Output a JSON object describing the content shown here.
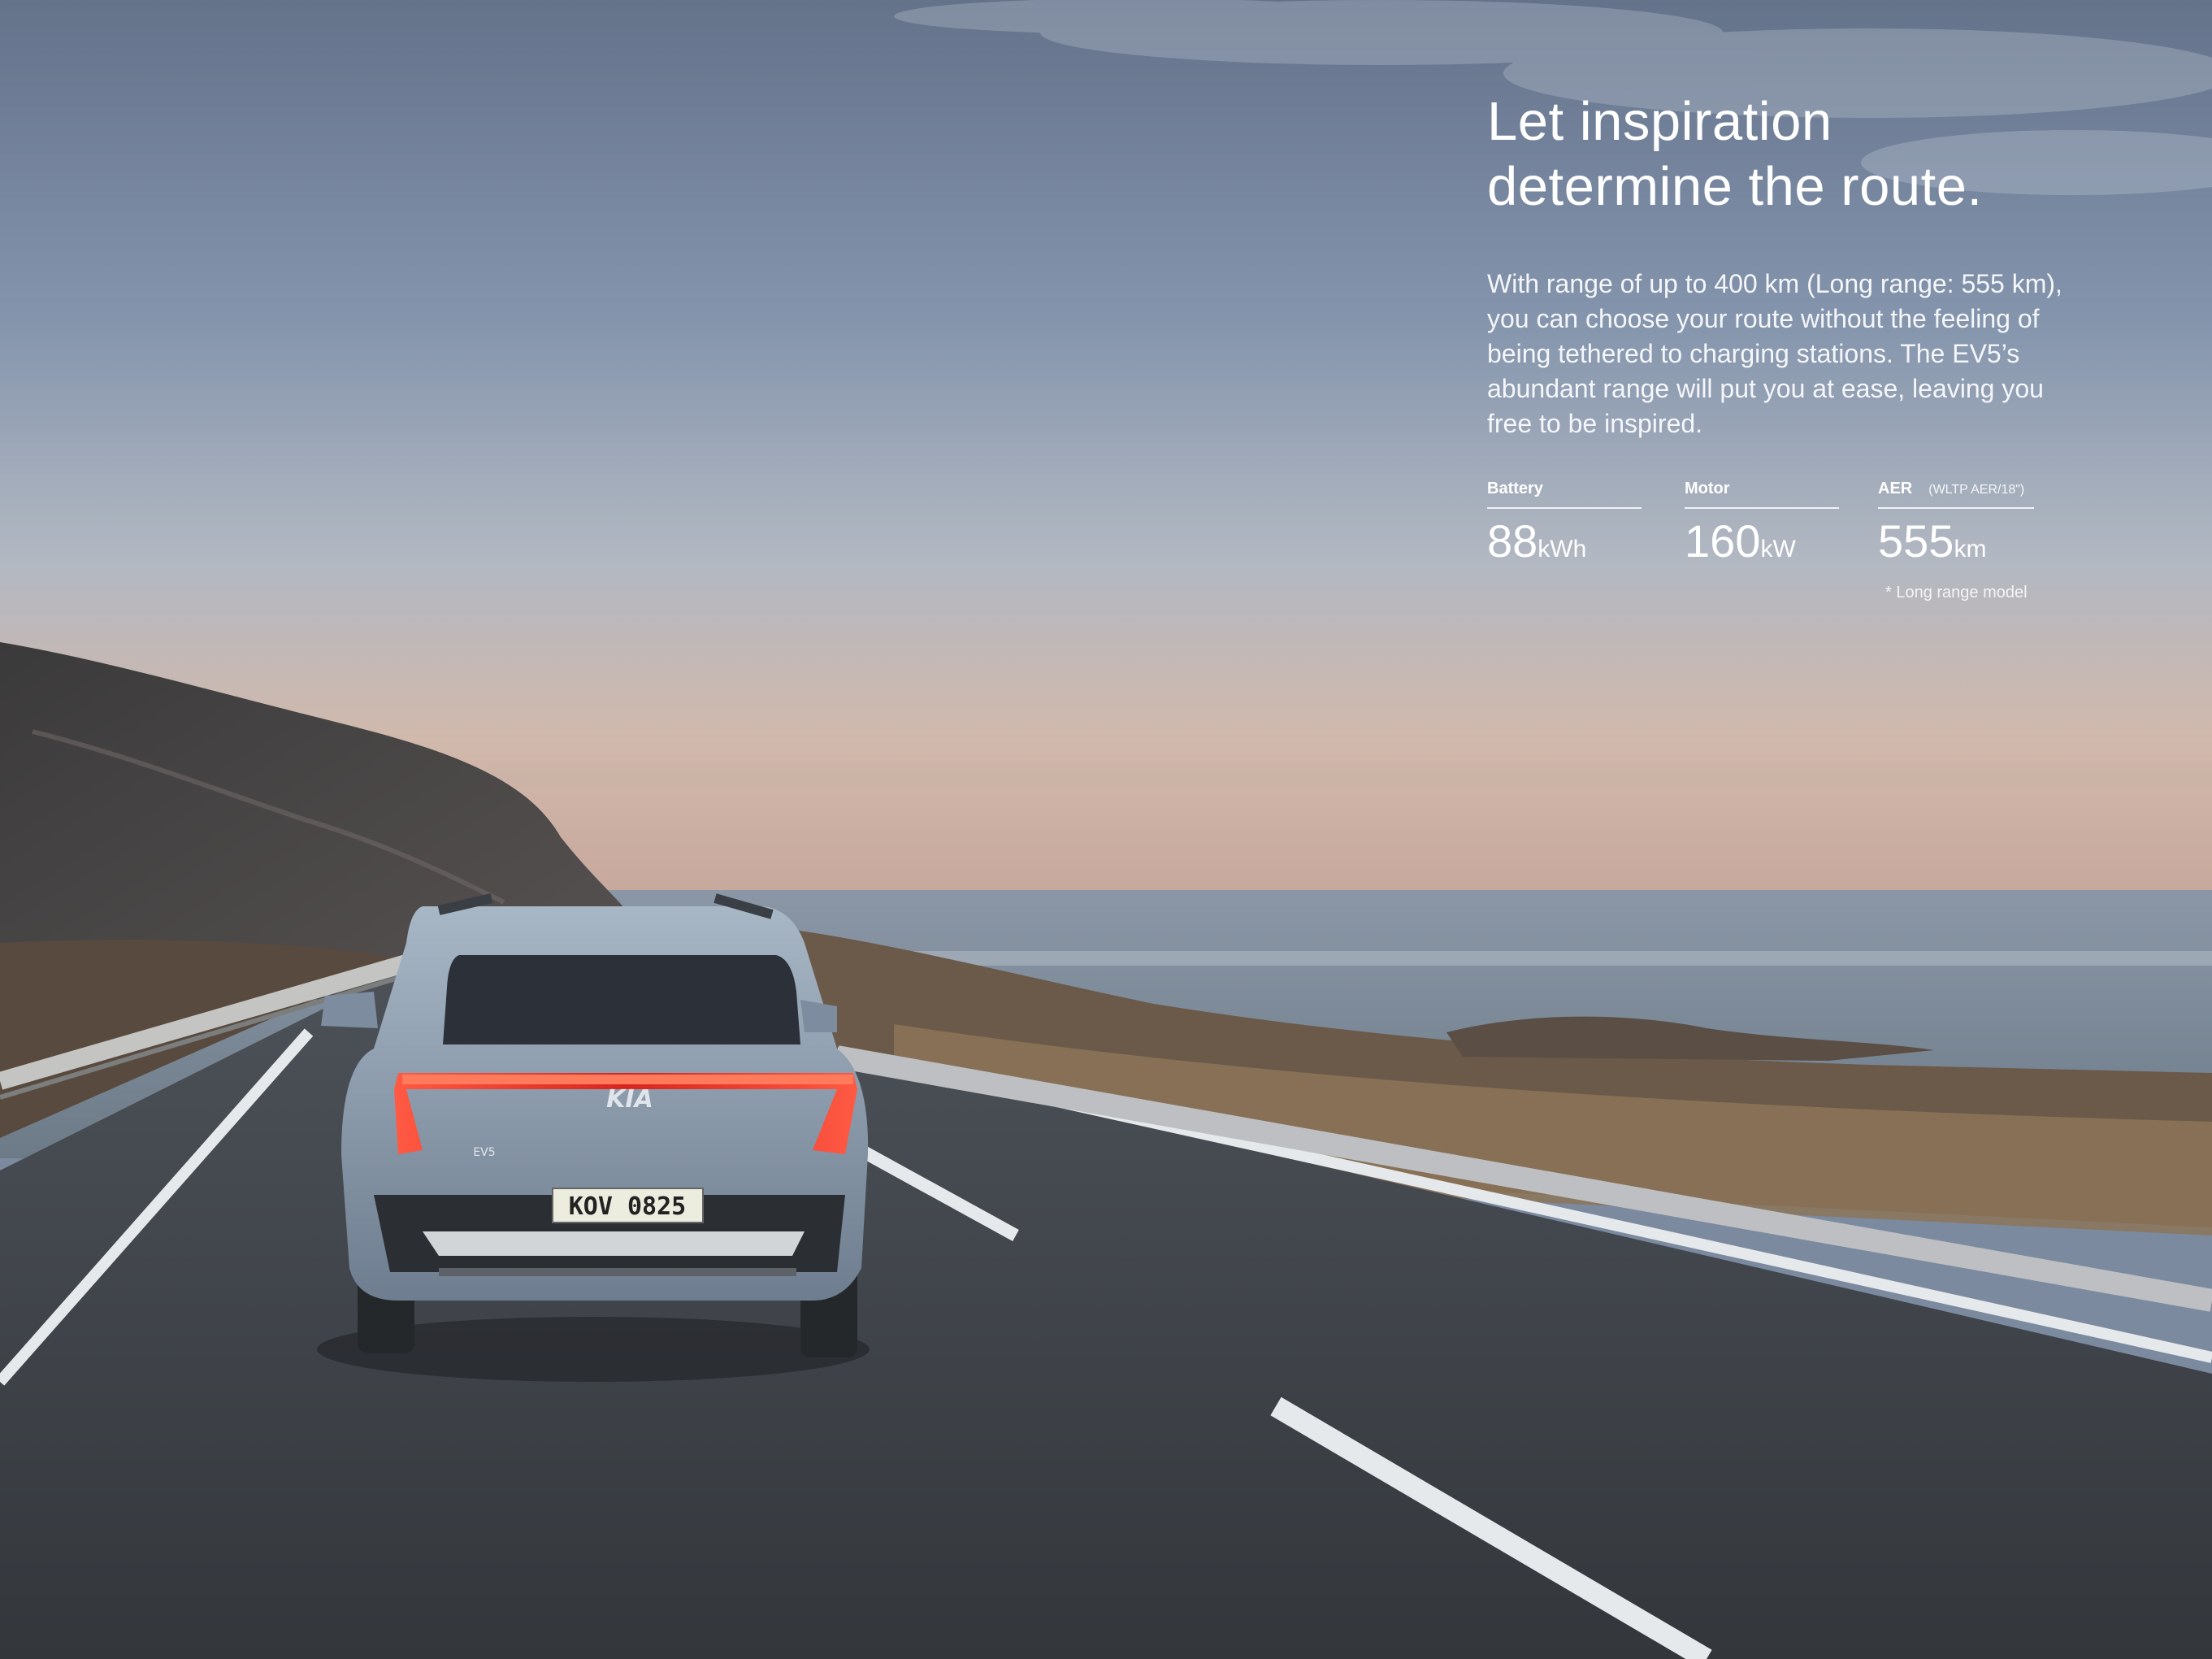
{
  "headline": {
    "line1": "Let inspiration",
    "line2": "determine the route."
  },
  "body_text": "With range of up to 400 km (Long range: 555 km), you can choose your route without the feeling of being tethered to charging stations. The EV5’s abundant range will put you at ease, leaving you free to be inspired.",
  "specs": [
    {
      "label": "Battery",
      "note": "",
      "value": "88",
      "unit": "kWh"
    },
    {
      "label": "Motor",
      "note": "",
      "value": "160",
      "unit": "kW"
    },
    {
      "label": "AER",
      "note": "(WLTP AER/18\")",
      "value": "555",
      "unit": "km"
    }
  ],
  "footnote": "* Long range model",
  "photo": {
    "license_plate": "KOV 0825",
    "brand_badge": "KIA",
    "model_badge": "EV5"
  },
  "colors": {
    "sky_top": "#66748c",
    "sky_mid": "#96a4b6",
    "horizon": "#d7b7a6",
    "sea": "#7d8c9b",
    "road": "#3d4248",
    "car_body": "#8c9db0",
    "tail_light": "#e5342c"
  }
}
